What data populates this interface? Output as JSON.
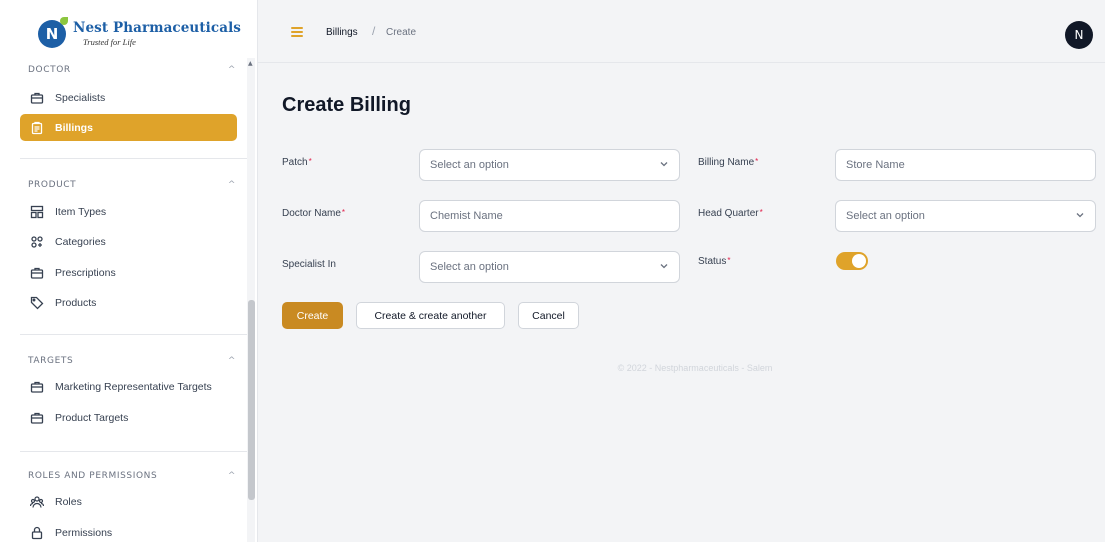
{
  "brand": {
    "name": "Nest Pharmaceuticals",
    "tagline": "Trusted for Life",
    "logo_letter": "N"
  },
  "sidebar": {
    "groups": [
      {
        "title": "DOCTOR",
        "items": [
          {
            "label": "Specialists",
            "icon": "briefcase-icon"
          },
          {
            "label": "Billings",
            "icon": "clipboard-icon",
            "active": true
          }
        ]
      },
      {
        "title": "PRODUCT",
        "items": [
          {
            "label": "Item Types",
            "icon": "grid-icon"
          },
          {
            "label": "Categories",
            "icon": "categories-icon"
          },
          {
            "label": "Prescriptions",
            "icon": "briefcase-icon"
          },
          {
            "label": "Products",
            "icon": "tag-icon"
          }
        ]
      },
      {
        "title": "TARGETS",
        "items": [
          {
            "label": "Marketing Representative Targets",
            "icon": "briefcase-icon"
          },
          {
            "label": "Product Targets",
            "icon": "briefcase-icon"
          }
        ]
      },
      {
        "title": "ROLES AND PERMISSIONS",
        "items": [
          {
            "label": "Roles",
            "icon": "users-icon"
          },
          {
            "label": "Permissions",
            "icon": "lock-icon"
          }
        ]
      }
    ],
    "accent_color": "#dfa32a"
  },
  "header": {
    "breadcrumb": {
      "parent": "Billings",
      "separator": "/",
      "current": "Create"
    },
    "avatar_letter": "N"
  },
  "main": {
    "title": "Create Billing",
    "fields": {
      "patch": {
        "label": "Patch",
        "placeholder": "Select an option"
      },
      "billing_name": {
        "label": "Billing Name",
        "placeholder": "Store Name"
      },
      "doctor_name": {
        "label": "Doctor Name",
        "placeholder": "Chemist Name"
      },
      "head_quarter": {
        "label": "Head Quarter",
        "placeholder": "Select an option"
      },
      "specialist_in": {
        "label": "Specialist In",
        "placeholder": "Select an option"
      },
      "status": {
        "label": "Status",
        "enabled": true
      }
    },
    "required_mark": "*",
    "buttons": {
      "create": "Create",
      "create_another": "Create & create another",
      "cancel": "Cancel"
    },
    "footer": "© 2022 - Nestpharmaceuticals - Salem"
  }
}
